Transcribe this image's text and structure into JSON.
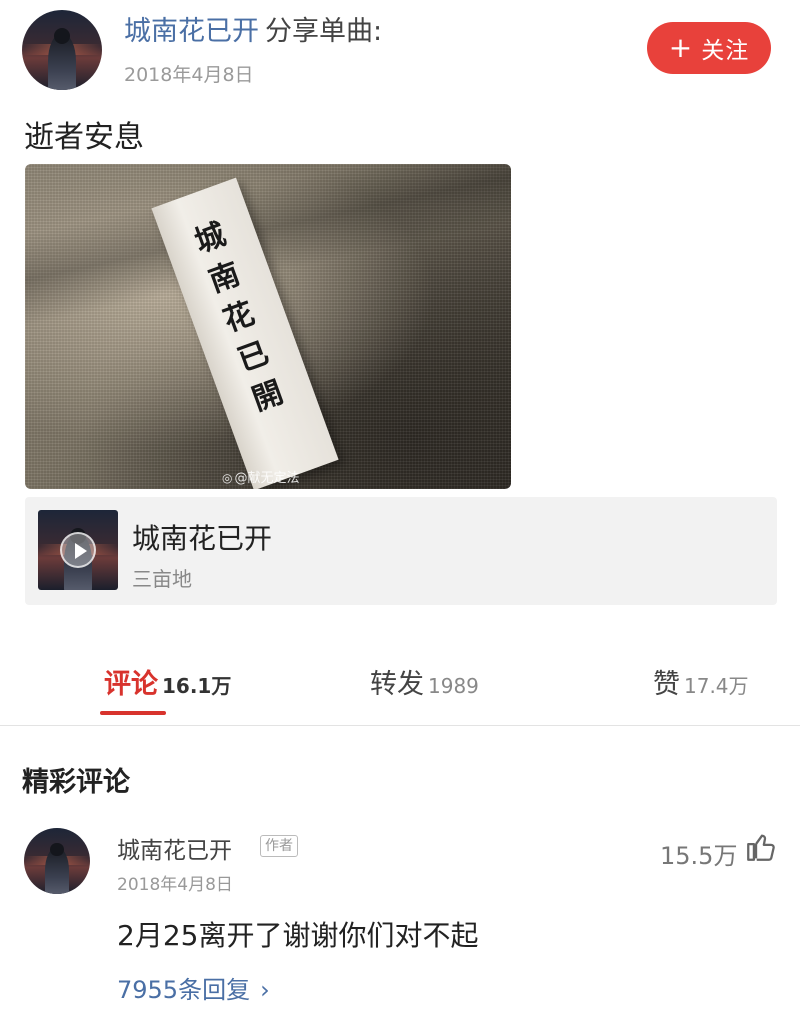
{
  "post": {
    "author": "城南花已开",
    "action": "分享单曲:",
    "date": "2018年4月8日",
    "follow_label": "关注",
    "text": "逝者安息"
  },
  "photo": {
    "paper_text": "城南花已開",
    "watermark": "@献无定法"
  },
  "song": {
    "title": "城南花已开",
    "artist": "三亩地"
  },
  "tabs": [
    {
      "label": "评论",
      "count": "16.1万",
      "active": true
    },
    {
      "label": "转发",
      "count": "1989",
      "active": false
    },
    {
      "label": "赞",
      "count": "17.4万",
      "active": false
    }
  ],
  "section_title": "精彩评论",
  "comment": {
    "author": "城南花已开",
    "author_tag": "作者",
    "date": "2018年4月8日",
    "likes": "15.5万",
    "text": "2月25离开了谢谢你们对不起",
    "replies": "7955条回复"
  },
  "colors": {
    "accent_red": "#d8332d",
    "follow_button": "#e8413b",
    "link_blue": "#4a6fa5"
  },
  "icons": [
    "plus-icon",
    "play-icon",
    "thumbs-up-icon",
    "chevron-right-icon",
    "weibo-icon"
  ]
}
